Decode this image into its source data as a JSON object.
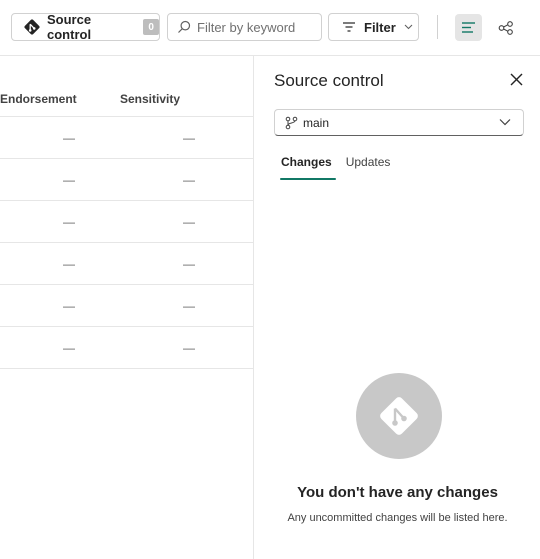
{
  "toolbar": {
    "source_control_label": "Source control",
    "source_control_count": "0",
    "search_placeholder": "Filter by keyword",
    "filter_label": "Filter"
  },
  "table": {
    "headers": [
      "Endorsement",
      "Sensitivity"
    ],
    "rows": [
      [
        "—",
        "—"
      ],
      [
        "—",
        "—"
      ],
      [
        "—",
        "—"
      ],
      [
        "—",
        "—"
      ],
      [
        "—",
        "—"
      ],
      [
        "—",
        "—"
      ]
    ]
  },
  "panel": {
    "title": "Source control",
    "branch": "main",
    "tabs": [
      {
        "label": "Changes",
        "active": true
      },
      {
        "label": "Updates",
        "active": false
      }
    ],
    "empty_title": "You don't have any changes",
    "empty_subtitle": "Any uncommitted changes will be listed here."
  },
  "colors": {
    "accent": "#117865",
    "border": "#d1d1d1",
    "empty_icon_bg": "#c8c8c8"
  },
  "icons": [
    "git-icon",
    "search-icon",
    "filter-icon",
    "chevron-down-icon",
    "list-view-icon",
    "lineage-view-icon",
    "close-icon",
    "branch-icon"
  ]
}
